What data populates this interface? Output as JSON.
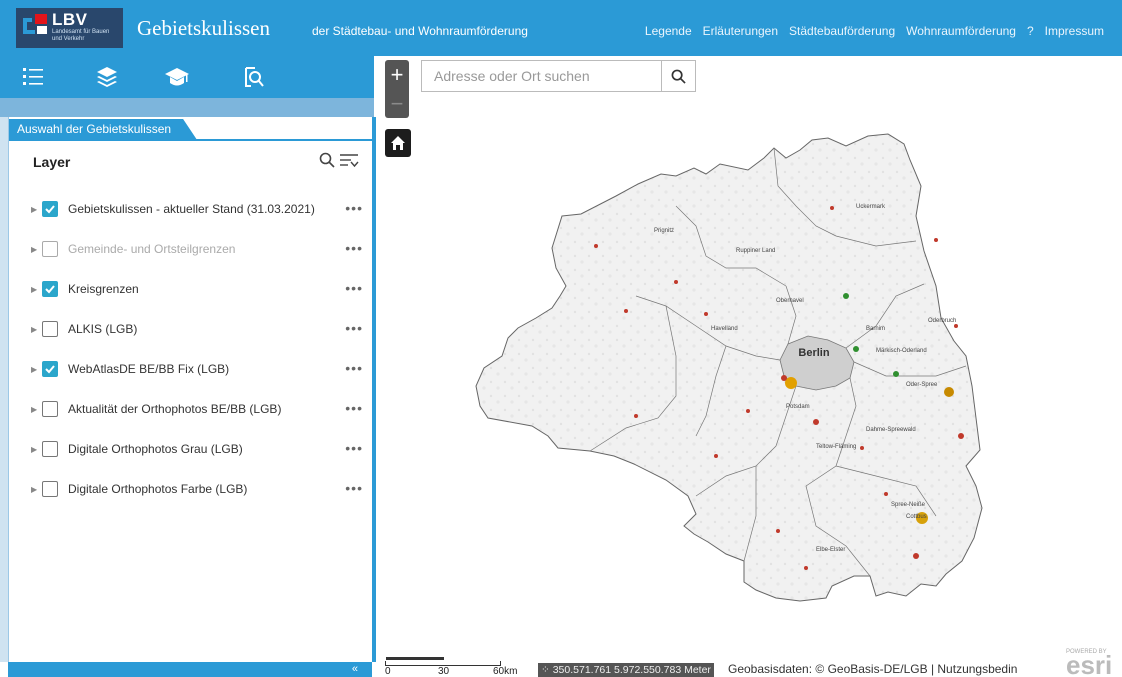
{
  "header": {
    "logo_text": "LBV",
    "logo_subtext": "Landesamt für Bauen und Verkehr",
    "title": "Gebietskulissen",
    "subtitle": "der Städtebau- und Wohnraumförderung",
    "nav": [
      "Legende",
      "Erläuterungen",
      "Städtebauförderung",
      "Wohnraumförderung",
      "?",
      "Impressum"
    ]
  },
  "toolbar": {
    "icons": [
      "layer-list-icon",
      "layers-icon",
      "graduation-cap-icon",
      "query-icon"
    ]
  },
  "panel": {
    "tab_label": "Auswahl der Gebietskulissen",
    "layer_heading": "Layer",
    "more_label": "•••",
    "collapse_label": "«",
    "layers": [
      {
        "label": "Gebietskulissen - aktueller Stand (31.03.2021)",
        "checked": true,
        "enabled": true
      },
      {
        "label": "Gemeinde- und Ortsteilgrenzen",
        "checked": false,
        "enabled": false
      },
      {
        "label": "Kreisgrenzen",
        "checked": true,
        "enabled": true
      },
      {
        "label": "ALKIS (LGB)",
        "checked": false,
        "enabled": true
      },
      {
        "label": "WebAtlasDE BE/BB Fix (LGB)",
        "checked": true,
        "enabled": true
      },
      {
        "label": "Aktualität der Orthophotos BE/BB (LGB)",
        "checked": false,
        "enabled": true
      },
      {
        "label": "Digitale Orthophotos Grau (LGB)",
        "checked": false,
        "enabled": true
      },
      {
        "label": "Digitale Orthophotos Farbe (LGB)",
        "checked": false,
        "enabled": true
      }
    ]
  },
  "map": {
    "zoom_in": "+",
    "zoom_out": "−",
    "search_placeholder": "Adresse oder Ort suchen",
    "scale_labels": [
      "0",
      "30",
      "60km"
    ],
    "coordinates": "350.571.761 5.972.550.783 Meter",
    "attribution": "Geobasisdaten: © GeoBasis-DE/LGB | Nutzungsbedin",
    "esri_powered": "POWERED BY",
    "esri_logo": "esri",
    "city_label": "Berlin",
    "place_labels": [
      "Prignitz",
      "Uckermark",
      "Ruppiner Land",
      "Havelland",
      "Oberhavel",
      "Barnim",
      "Märkisch-Oderland",
      "Oderbruch",
      "Teltow-Fläming",
      "Dahme-Spreewald",
      "Oder-Spree",
      "Spree-Neiße",
      "Elbe-Elster",
      "Potsdam",
      "Cottbus"
    ]
  },
  "colors": {
    "accent": "#2b9ad6",
    "checkbox": "#2ba6cb",
    "logo_bg": "#29476c"
  }
}
